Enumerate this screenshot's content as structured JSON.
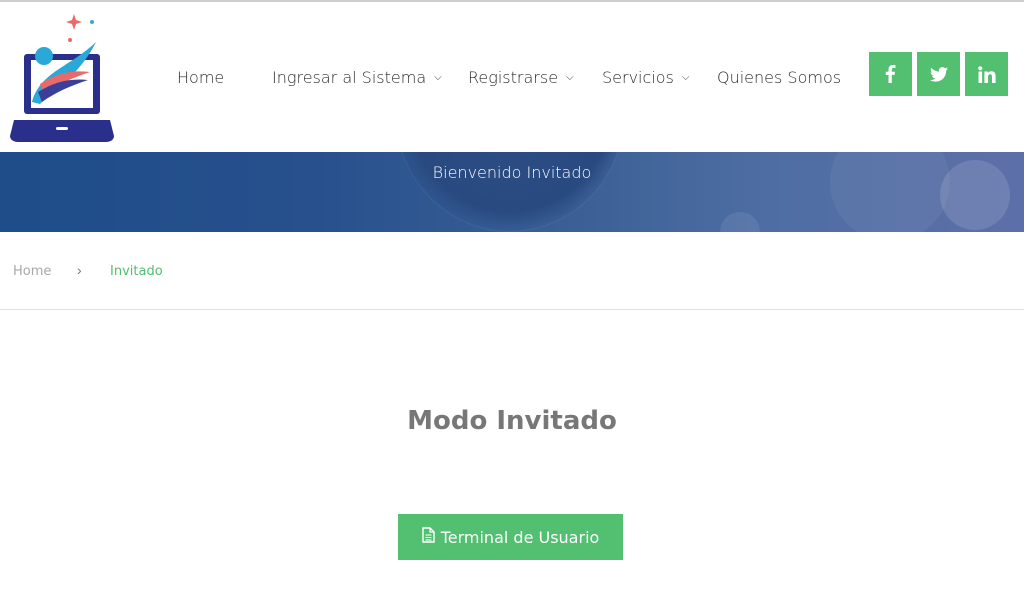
{
  "header": {
    "logo_icon": "laptop-logo-icon",
    "nav": [
      {
        "label": "Home",
        "has_caret": false
      },
      {
        "label": "Ingresar al Sistema",
        "has_caret": true
      },
      {
        "label": "Registrarse",
        "has_caret": true
      },
      {
        "label": "Servicios",
        "has_caret": true
      },
      {
        "label": "Quienes Somos",
        "has_caret": false
      }
    ],
    "social": [
      {
        "icon": "facebook-icon"
      },
      {
        "icon": "twitter-icon"
      },
      {
        "icon": "linkedin-icon"
      }
    ]
  },
  "banner": {
    "title": "Bienvenido Invitado"
  },
  "breadcrumb": {
    "home": "Home",
    "separator": "›",
    "current": "Invitado"
  },
  "main": {
    "title": "Modo Invitado",
    "button_label": "Terminal de Usuario",
    "button_icon": "document-icon"
  },
  "colors": {
    "accent": "#52bf71",
    "banner": "#27508c",
    "title": "#777777"
  }
}
